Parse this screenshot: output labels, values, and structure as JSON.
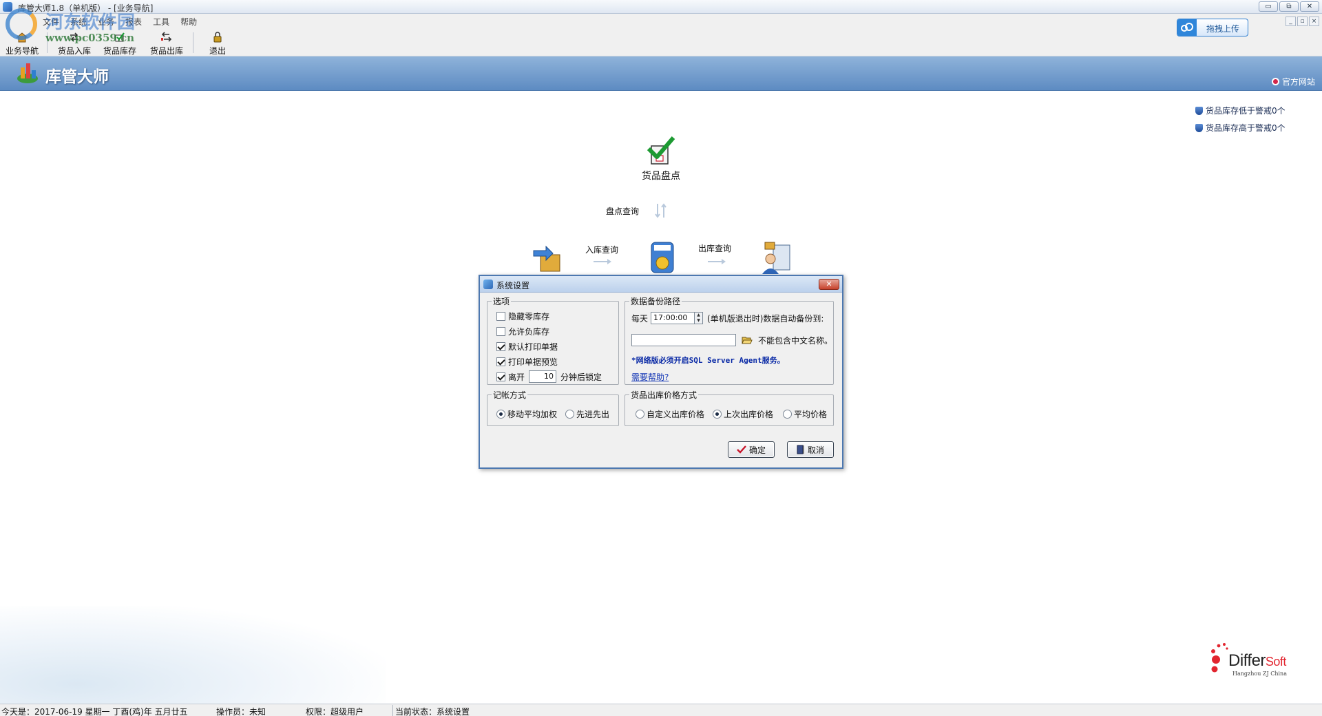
{
  "window": {
    "title": "库管大师1.8（单机版） - [业务导航]",
    "buttons": {
      "minimize": "▭",
      "restore": "⧉",
      "close": "✕"
    }
  },
  "menubar": {
    "items": [
      "文件",
      "系统",
      "业务",
      "报表",
      "工具",
      "帮助"
    ]
  },
  "watermark": {
    "text": "河东软件园",
    "url": "www.pc0359.cn"
  },
  "toolbar": {
    "items": [
      {
        "label": "业务导航",
        "icon": "home-icon"
      },
      {
        "label": "货品入库",
        "icon": "import-arrow-icon"
      },
      {
        "label": "货品库存",
        "icon": "inventory-check-icon"
      },
      {
        "label": "货品出库",
        "icon": "export-arrow-icon"
      },
      {
        "label": "退出",
        "icon": "lock-icon"
      }
    ]
  },
  "upload": {
    "label": "拖拽上传"
  },
  "banner": {
    "brand": "库管大师",
    "site_link": "官方网站"
  },
  "alerts": [
    "货品库存低于警戒0个",
    "货品库存高于警戒0个"
  ],
  "flow": {
    "check": "货品盘点",
    "check_query": "盘点查询",
    "in_query": "入库查询",
    "out_query": "出库查询"
  },
  "dialog": {
    "title": "系统设置",
    "options": {
      "legend": "选项",
      "hide_zero": {
        "label": "隐藏零库存",
        "checked": false
      },
      "allow_negative": {
        "label": "允许负库存",
        "checked": false
      },
      "default_print": {
        "label": "默认打印单据",
        "checked": true
      },
      "print_preview": {
        "label": "打印单据预览",
        "checked": true
      },
      "lock_leave": {
        "label": "离开",
        "checked": true,
        "minutes": "10",
        "suffix": "分钟后锁定"
      }
    },
    "backup": {
      "legend": "数据备份路径",
      "daily": "每天",
      "time": "17:00:00",
      "desc": "(单机版退出时)数据自动备份到:",
      "path": "",
      "no_chinese": "不能包含中文名称。",
      "note": "*网络版必须开启SQL Server Agent服务。",
      "help": "需要帮助?"
    },
    "accounting": {
      "legend": "记帐方式",
      "options": [
        {
          "label": "移动平均加权",
          "selected": true
        },
        {
          "label": "先进先出",
          "selected": false
        }
      ]
    },
    "price": {
      "legend": "货品出库价格方式",
      "options": [
        {
          "label": "自定义出库价格",
          "selected": false
        },
        {
          "label": "上次出库价格",
          "selected": true
        },
        {
          "label": "平均价格",
          "selected": false
        }
      ]
    },
    "ok": "确定",
    "cancel": "取消",
    "close": "✕"
  },
  "differsoft": {
    "name": "Differ",
    "name_suffix": "Soft",
    "sub": "Hangzhou ZJ China"
  },
  "status": {
    "today": "今天是：2017-06-19 星期一 丁酉(鸡)年 五月廿五",
    "operator": "操作员：未知",
    "permission": "权限：超级用户",
    "state": "当前状态：系统设置"
  }
}
